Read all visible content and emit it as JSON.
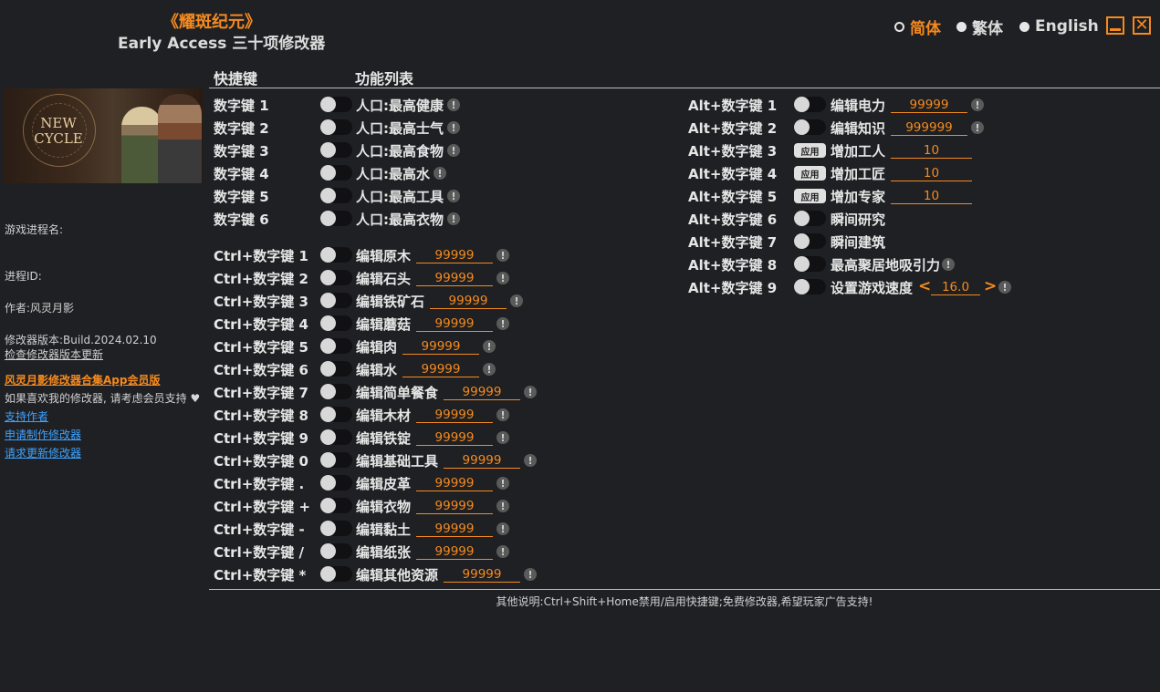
{
  "header": {
    "game_title": "《耀斑纪元》",
    "subtitle": "Early Access 三十项修改器",
    "languages": [
      {
        "label": "简体",
        "selected": true
      },
      {
        "label": "繁体",
        "selected": false
      },
      {
        "label": "English",
        "selected": false
      }
    ],
    "minimize_icon": "minimize-icon",
    "close_icon": "close-icon",
    "close_glyph": "✕"
  },
  "cover": {
    "logo_line1": "NEW",
    "logo_line2": "CYCLE"
  },
  "sidebar": {
    "process_name_label": "游戏进程名:",
    "process_id_label": "进程ID:",
    "author": "作者:风灵月影",
    "version": "修改器版本:Build.2024.02.10",
    "check_update": "检查修改器版本更新",
    "app_link": "风灵月影修改器合集App会员版",
    "support_text": "如果喜欢我的修改器, 请考虑会员支持",
    "heart_glyph": "♥",
    "links": [
      "支持作者",
      "申请制作修改器",
      "请求更新修改器"
    ]
  },
  "columns": {
    "hotkey": "快捷键",
    "features": "功能列表"
  },
  "left_rows": [
    {
      "key": "数字键 1",
      "label": "人口:最高健康",
      "info": true
    },
    {
      "key": "数字键 2",
      "label": "人口:最高士气",
      "info": true
    },
    {
      "key": "数字键 3",
      "label": "人口:最高食物",
      "info": true
    },
    {
      "key": "数字键 4",
      "label": "人口:最高水",
      "info": true
    },
    {
      "key": "数字键 5",
      "label": "人口:最高工具",
      "info": true
    },
    {
      "key": "数字键 6",
      "label": "人口:最高衣物",
      "info": true
    },
    {
      "key": "Ctrl+数字键 1",
      "label": "编辑原木",
      "value": "99999"
    },
    {
      "key": "Ctrl+数字键 2",
      "label": "编辑石头",
      "value": "99999"
    },
    {
      "key": "Ctrl+数字键 3",
      "label": "编辑铁矿石",
      "value": "99999"
    },
    {
      "key": "Ctrl+数字键 4",
      "label": "编辑蘑菇",
      "value": "99999"
    },
    {
      "key": "Ctrl+数字键 5",
      "label": "编辑肉",
      "value": "99999"
    },
    {
      "key": "Ctrl+数字键 6",
      "label": "编辑水",
      "value": "99999"
    },
    {
      "key": "Ctrl+数字键 7",
      "label": "编辑简单餐食",
      "value": "99999"
    },
    {
      "key": "Ctrl+数字键 8",
      "label": "编辑木材",
      "value": "99999"
    },
    {
      "key": "Ctrl+数字键 9",
      "label": "编辑铁锭",
      "value": "99999"
    },
    {
      "key": "Ctrl+数字键 0",
      "label": "编辑基础工具",
      "value": "99999"
    },
    {
      "key": "Ctrl+数字键 .",
      "label": "编辑皮革",
      "value": "99999"
    },
    {
      "key": "Ctrl+数字键 +",
      "label": "编辑衣物",
      "value": "99999"
    },
    {
      "key": "Ctrl+数字键 -",
      "label": "编辑黏土",
      "value": "99999"
    },
    {
      "key": "Ctrl+数字键 /",
      "label": "编辑纸张",
      "value": "99999"
    },
    {
      "key": "Ctrl+数字键 *",
      "label": "编辑其他资源",
      "value": "99999"
    }
  ],
  "right_rows": [
    {
      "key": "Alt+数字键 1",
      "control": "toggle",
      "label": "编辑电力",
      "value": "99999",
      "info": true
    },
    {
      "key": "Alt+数字键 2",
      "control": "toggle",
      "label": "编辑知识",
      "value": "999999",
      "info": true
    },
    {
      "key": "Alt+数字键 3",
      "control": "apply",
      "apply_label": "应用",
      "label": "增加工人",
      "value": "10"
    },
    {
      "key": "Alt+数字键 4",
      "control": "apply",
      "apply_label": "应用",
      "label": "增加工匠",
      "value": "10"
    },
    {
      "key": "Alt+数字键 5",
      "control": "apply",
      "apply_label": "应用",
      "label": "增加专家",
      "value": "10"
    },
    {
      "key": "Alt+数字键 6",
      "control": "toggle",
      "label": "瞬间研究"
    },
    {
      "key": "Alt+数字键 7",
      "control": "toggle",
      "label": "瞬间建筑"
    },
    {
      "key": "Alt+数字键 8",
      "control": "toggle",
      "label": "最高聚居地吸引力",
      "info": true
    },
    {
      "key": "Alt+数字键 9",
      "control": "toggle",
      "label": "设置游戏速度",
      "value": "16.0",
      "stepper": true,
      "info": true
    }
  ],
  "stepper": {
    "dec": "<",
    "inc": ">"
  },
  "info_glyph": "!",
  "footer": "其他说明:Ctrl+Shift+Home禁用/启用快捷键;免费修改器,希望玩家广告支持!",
  "colors": {
    "accent": "#f58a1f",
    "background": "#1f2023",
    "link": "#3ea2ff"
  }
}
